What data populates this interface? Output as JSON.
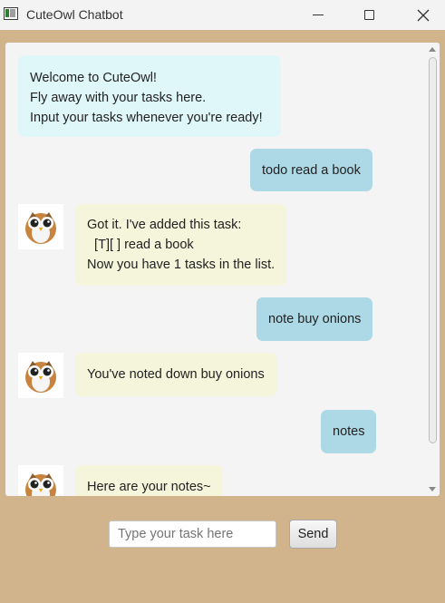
{
  "window": {
    "title": "CuteOwl Chatbot"
  },
  "messages": [
    {
      "sender": "bot",
      "text": "Welcome to CuteOwl!\nFly away with your tasks here.\nInput your tasks whenever you're ready!"
    },
    {
      "sender": "user",
      "text": "todo read a book"
    },
    {
      "sender": "bot",
      "text": "Got it. I've added this task:\n  [T][ ] read a book\nNow you have 1 tasks in the list."
    },
    {
      "sender": "user",
      "text": "note buy onions"
    },
    {
      "sender": "bot",
      "text": "You've noted down buy onions"
    },
    {
      "sender": "user",
      "text": "notes"
    },
    {
      "sender": "bot",
      "text": "Here are your notes~"
    }
  ],
  "input": {
    "placeholder": "Type your task here",
    "value": ""
  },
  "send_button": {
    "label": "Send"
  },
  "colors": {
    "background": "#d2b48c",
    "user_bubble": "#add8e6",
    "bot_bubble": "#f5f5dc",
    "welcome_bubble": "#e0f7fa"
  }
}
